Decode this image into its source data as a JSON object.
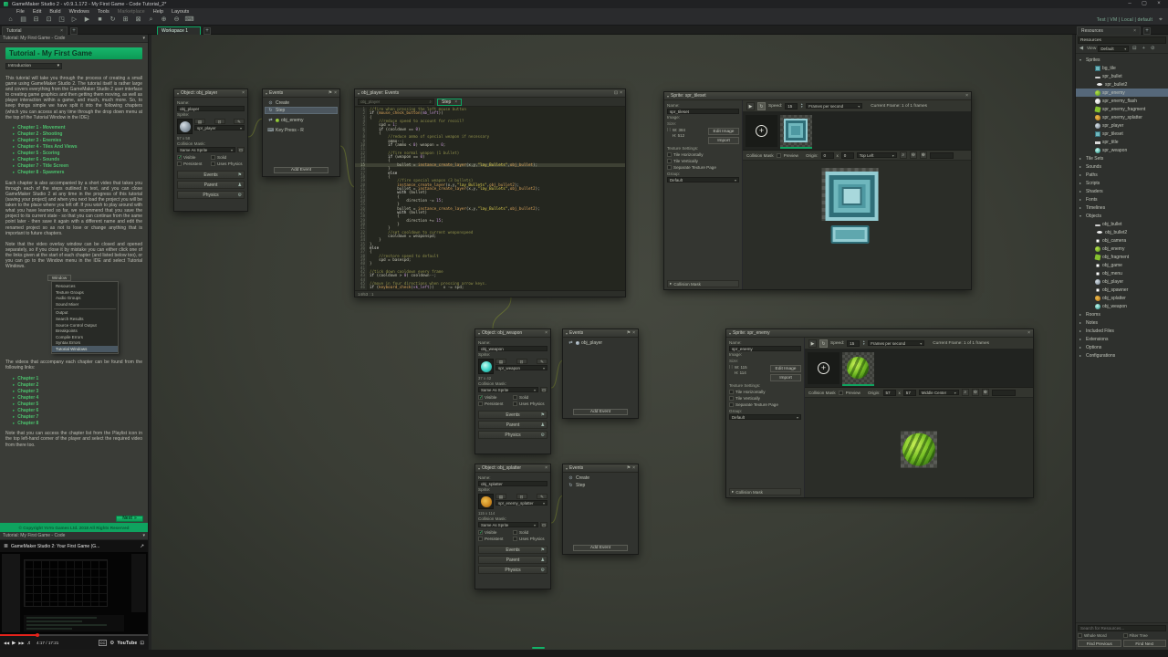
{
  "titlebar": {
    "title": "GameMaker Studio 2 - v0.9.1.172 - My First Game - Code Tutorial_2*",
    "minimize": "–",
    "maximize": "▢",
    "close": "×"
  },
  "menubar": {
    "items": [
      {
        "label": "File"
      },
      {
        "label": "Edit"
      },
      {
        "label": "Build"
      },
      {
        "label": "Windows"
      },
      {
        "label": "Tools"
      },
      {
        "label": "Marketplace",
        "dim": true
      },
      {
        "label": "Help"
      },
      {
        "label": "Layouts"
      }
    ],
    "right_status": "Test | VM | Local | default",
    "target_icon": "⌖"
  },
  "toolbar": {
    "icons": [
      {
        "glyph": "⌂",
        "name": "home-icon"
      },
      {
        "glyph": "▤",
        "name": "new-project-icon"
      },
      {
        "glyph": "⊟",
        "name": "open-project-icon"
      },
      {
        "glyph": "⊡",
        "name": "save-project-icon"
      },
      {
        "glyph": "◳",
        "name": "target-config-icon"
      },
      {
        "glyph": "▷",
        "name": "debug-icon"
      },
      {
        "glyph": "▶",
        "name": "run-icon"
      },
      {
        "glyph": "■",
        "name": "stop-icon"
      },
      {
        "glyph": "↻",
        "name": "clean-icon"
      },
      {
        "glyph": "⊞",
        "name": "game-options-icon"
      },
      {
        "glyph": "⊠",
        "name": "texture-icon"
      },
      {
        "glyph": "⌕",
        "name": "zoom-icon"
      },
      {
        "glyph": "⊕",
        "name": "zoom-in-icon"
      },
      {
        "glyph": "⊖",
        "name": "zoom-out-icon"
      },
      {
        "glyph": "⌨",
        "name": "laptop-icon"
      }
    ]
  },
  "tabs": {
    "tutorial": "Tutorial",
    "workspace": "Workspace 1",
    "resources": "Resources",
    "close": "×",
    "plus": "+"
  },
  "tutorial_panel": {
    "header": "Tutorial: My First Game - Code",
    "title": "Tutorial - My First Game",
    "dropdown_value": "Introduction",
    "para1": "This tutorial will take you through the process of creating a small game using GameMaker Studio 2. The tutorial itself is rather large and covers everything from the GameMaker Studio 2 user interface to creating game graphics and then getting them moving, as well as player interaction within a game, and much, much more. So, to keep things simple we have split it into the following chapters (which you can access at any time through the drop down menu at the top of the Tutorial Window in the IDE):",
    "chapters_full": [
      {
        "label": "Chapter 1 - Movement"
      },
      {
        "label": "Chapter 2 - Shooting"
      },
      {
        "label": "Chapter 3 - Enemies"
      },
      {
        "label": "Chapter 4 - Tiles And Views"
      },
      {
        "label": "Chapter 5 - Scoring"
      },
      {
        "label": "Chapter 6 - Sounds"
      },
      {
        "label": "Chapter 7 - Title Screen"
      },
      {
        "label": "Chapter 8 - Spawners"
      }
    ],
    "para2": "Each chapter is also accompanied by a short video that takes you through each of the steps outlined in text, and you can close GameMaker Studio 2 at any time in the progress of this tutorial (saving your project) and when you next load the project you will be taken to the place where you left off. If you wish to play around with what you have learned so far, we recommend that you save the project to its current state - so that you can continue from the same point later - then save it again with a different name and edit the renamed project so as not to lose or change anything that is important to future chapters.",
    "para3": "Note that the video overlay window can be closed and opened separately, so if you close it by mistake you can either click one of the links given at the start of each chapter (and listed below too), or you can go to the Window menu in the IDE and select Tutorial Windows.",
    "window_menu": {
      "button": "Window",
      "items": [
        {
          "label": "Resources"
        },
        {
          "label": "Texture Groups"
        },
        {
          "label": "Audio Groups"
        },
        {
          "label": "Sound Mixer"
        },
        {
          "sep": true
        },
        {
          "label": "Output"
        },
        {
          "label": "Search Results"
        },
        {
          "label": "Source Control Output"
        },
        {
          "label": "Breakpoints"
        },
        {
          "label": "Compile Errors"
        },
        {
          "label": "Syntax Errors"
        },
        {
          "label": "Tutorial Windows",
          "selected": true
        }
      ]
    },
    "para4": "The videos that accompany each chapter can be found from the following links:",
    "chapters_short": [
      {
        "label": "Chapter 1"
      },
      {
        "label": "Chapter 2"
      },
      {
        "label": "Chapter 3"
      },
      {
        "label": "Chapter 4"
      },
      {
        "label": "Chapter 5"
      },
      {
        "label": "Chapter 6"
      },
      {
        "label": "Chapter 7"
      },
      {
        "label": "Chapter 8"
      }
    ],
    "para5": "Note that you can access the chapter list from the Playlist icon in the top left-hand corner of the player and select the required video from there too.",
    "next_label": "Next",
    "next_arrow": "»",
    "copyright": "© Copyright YoYo Games Ltd. 2018 All Rights Reserved"
  },
  "video_panel": {
    "header": "Tutorial: My First Game - Code",
    "playlist_icon": "≣",
    "title": "GameMaker Studio 2: Your First Game (G...",
    "share_icon": "↗",
    "time": "4:17 / 17:21",
    "progress_pct": 25,
    "controls": {
      "prev": "◀◀",
      "play": "▶",
      "next": "▶▶",
      "volume": "♬",
      "cc": "CC",
      "settings": "⚙",
      "brand": "YouTube",
      "fullscreen": "⊡"
    }
  },
  "windows_objects": {
    "player": {
      "title": "Object: obj_player",
      "name_label": "Name:",
      "name": "obj_player",
      "sprite_label": "Sprite:",
      "sprite": "spr_player",
      "size": "57 x 58",
      "collision_label": "Collision Mask:",
      "collision": "Same As Sprite",
      "check_labels": {
        "visible": "Visible",
        "solid": "Solid",
        "persistent": "Persistent",
        "physics": "Uses Physics"
      },
      "checks": {
        "visible": true,
        "solid": false,
        "persistent": false,
        "physics": false
      },
      "buttons": {
        "events": "Events",
        "parent": "Parent",
        "physics": "Physics"
      }
    },
    "weapon": {
      "title": "Object: obj_weapon",
      "name_label": "Name:",
      "name": "obj_weapon",
      "sprite_label": "Sprite:",
      "sprite": "spr_weapon",
      "size": "37 x 42",
      "collision_label": "Collision Mask:",
      "collision": "Same As Sprite",
      "check_labels": {
        "visible": "Visible",
        "solid": "Solid",
        "persistent": "Persistent",
        "physics": "Uses Physics"
      },
      "checks": {
        "visible": true,
        "solid": false,
        "persistent": false,
        "physics": false
      },
      "buttons": {
        "events": "Events",
        "parent": "Parent",
        "physics": "Physics"
      }
    },
    "splatter": {
      "title": "Object: obj_splatter",
      "name_label": "Name:",
      "name": "obj_splatter",
      "sprite_label": "Sprite:",
      "sprite": "spr_enemy_splatter",
      "size": "115 x 114",
      "collision_label": "Collision Mask:",
      "collision": "Same As Sprite",
      "check_labels": {
        "visible": "Visible",
        "solid": "Solid",
        "persistent": "Persistent",
        "physics": "Uses Physics"
      },
      "checks": {
        "visible": true,
        "solid": false,
        "persistent": false,
        "physics": false
      },
      "buttons": {
        "events": "Events",
        "parent": "Parent",
        "physics": "Physics"
      }
    }
  },
  "windows_events": {
    "player": {
      "title": "Events",
      "items": [
        {
          "label": "Create",
          "icon": "event-create"
        },
        {
          "label": "Step",
          "icon": "event-step",
          "selected": true
        },
        {
          "label": "obj_enemy",
          "icon": "event-collision",
          "icon2": "dot-green",
          "gap": true
        },
        {
          "label": "Key Press - R",
          "icon": "event-keypress",
          "gap": true
        }
      ],
      "add_label": "Add Event"
    },
    "weapon": {
      "title": "Events",
      "items": [
        {
          "label": "obj_player",
          "icon": "event-collision",
          "icon2": "dot-globe"
        }
      ],
      "add_label": "Add Event"
    },
    "splatter": {
      "title": "Events",
      "items": [
        {
          "label": "Create",
          "icon": "event-create"
        },
        {
          "label": "Step",
          "icon": "event-step"
        }
      ],
      "add_label": "Add Event"
    }
  },
  "code_editor": {
    "title": "obj_player: Events",
    "goto_text": "obj_player",
    "search_icon": "⌕",
    "tab": "Step",
    "status": "14/53 : 1",
    "highlight_line": 15,
    "lines": [
      "//fire when pressing the left mouse button",
      "if (mouse_check_button(mb_left))",
      "{",
      "    //reduce speed to account for recoil?",
      "    spd = 1;",
      "    if (cooldown == 0)",
      "    {",
      "        //reduce ammo of special weapon if necessary",
      "        ammo--;",
      "        if (ammo < 0) weapon = 0;",
      "",
      "        //fire normal weapon (1 bullet)",
      "        if (weapon == 0)",
      "        {",
      "            bullet = instance_create_layer(x,y,\"lay_Bullets\",obj_bullet);",
      "        }",
      "        else",
      "        {",
      "            //fire special weapon (3 bullets)",
      "            instance_create_layer(x,y,\"lay_Bullets\",obj_bullet2);",
      "            bullet = instance_create_layer(x,y,\"lay_Bullets\",obj_bullet2);",
      "            with (bullet)",
      "            {",
      "                direction -= 15;",
      "            }",
      "            bullet = instance_create_layer(x,y,\"lay_Bullets\",obj_bullet2);",
      "            with (bullet)",
      "            {",
      "                direction += 15;",
      "            }",
      "        }",
      "        //set cooldown to current weaponspeed",
      "        cooldown = weaponspd;",
      "    }",
      "}",
      "else",
      "{",
      "    //restore speed to default",
      "    spd = basespd;",
      "}",
      "",
      "//tick down cooldown every frame",
      "if (cooldown > 0) cooldown--;",
      "",
      "//move in four directions when pressing arrow keys.",
      "if (keyboard_check(vk_left))    x -= spd;"
    ]
  },
  "windows_sprites": {
    "tileset": {
      "title": "Sprite: spr_tileset",
      "name_label": "Name:",
      "name": "spr_tileset",
      "image_label": "Image:",
      "size_label": "Size:",
      "w_label": "W:",
      "w": "384",
      "h_label": "H:",
      "h": "512",
      "edit_image": "Edit Image",
      "import": "Import",
      "texture_label": "Texture Settings:",
      "tex_checks": [
        {
          "label": "Tile Horizontally"
        },
        {
          "label": "Tile Vertically"
        },
        {
          "label": "Separate Texture Page"
        }
      ],
      "group_label": "Group:",
      "group": "Default",
      "collision_section": "Collision Mask",
      "speed_label": "Speed:",
      "speed": "15",
      "speed_unit": "Frames per second",
      "current_frame": "Current Frame: 1 of 1 frames",
      "mask_label": "Collision Mask",
      "preview_label": "Preview",
      "origin_label": "Origin:",
      "origin_x": "0",
      "origin_sep": "x",
      "origin_y": "0",
      "origin_mode": "Top Left"
    },
    "enemy": {
      "title": "Sprite: spr_enemy",
      "name_label": "Name:",
      "name": "spr_enemy",
      "image_label": "Image:",
      "size_label": "Size:",
      "w_label": "W:",
      "w": "115",
      "h_label": "H:",
      "h": "114",
      "edit_image": "Edit Image",
      "import": "Import",
      "texture_label": "Texture Settings:",
      "tex_checks": [
        {
          "label": "Tile Horizontally"
        },
        {
          "label": "Tile Vertically"
        },
        {
          "label": "Separate Texture Page"
        }
      ],
      "group_label": "Group:",
      "group": "Default",
      "collision_section": "Collision Mask",
      "speed_label": "Speed:",
      "speed": "15",
      "speed_unit": "Frames per second",
      "current_frame": "Current Frame: 1 of 1 frames",
      "mask_label": "Collision Mask",
      "preview_label": "Preview",
      "origin_label": "Origin:",
      "origin_x": "57",
      "origin_sep": "x",
      "origin_y": "57",
      "origin_mode": "Middle Center"
    }
  },
  "resources_panel": {
    "caption": "Resources",
    "view_label": "View",
    "view_value": "Default",
    "tree": [
      {
        "label": "Sprites",
        "kind": true,
        "expanded": true
      },
      {
        "label": "bg_tile",
        "depth": 1,
        "icon": "sprite-tile"
      },
      {
        "label": "spr_bullet",
        "depth": 1,
        "icon": "sprite-bullet"
      },
      {
        "label": "spr_bullet2",
        "depth": 1,
        "icon": "sprite-bullet2"
      },
      {
        "label": "spr_enemy",
        "depth": 1,
        "icon": "sprite-enemy",
        "selected": true
      },
      {
        "label": "spr_enemy_flash",
        "depth": 1,
        "icon": "sprite-flash"
      },
      {
        "label": "spr_enemy_fragment",
        "depth": 1,
        "icon": "sprite-fragment"
      },
      {
        "label": "spr_enemy_splatter",
        "depth": 1,
        "icon": "sprite-splatter"
      },
      {
        "label": "spr_player",
        "depth": 1,
        "icon": "sprite-player"
      },
      {
        "label": "spr_tileset",
        "depth": 1,
        "icon": "sprite-tileset"
      },
      {
        "label": "spr_title",
        "depth": 1,
        "icon": "sprite-title"
      },
      {
        "label": "spr_weapon",
        "depth": 1,
        "icon": "sprite-weapon"
      },
      {
        "label": "Tile Sets",
        "kind": true
      },
      {
        "label": "Sounds",
        "kind": true
      },
      {
        "label": "Paths",
        "kind": true
      },
      {
        "label": "Scripts",
        "kind": true
      },
      {
        "label": "Shaders",
        "kind": true
      },
      {
        "label": "Fonts",
        "kind": true
      },
      {
        "label": "Timelines",
        "kind": true
      },
      {
        "label": "Objects",
        "kind": true,
        "expanded": true
      },
      {
        "label": "obj_bullet",
        "depth": 1,
        "icon": "sprite-bullet"
      },
      {
        "label": "obj_bullet2",
        "depth": 1,
        "icon": "sprite-bullet2"
      },
      {
        "label": "obj_camera",
        "depth": 1,
        "icon": "object-blank"
      },
      {
        "label": "obj_enemy",
        "depth": 1,
        "icon": "sprite-enemy"
      },
      {
        "label": "obj_fragment",
        "depth": 1,
        "icon": "sprite-fragment"
      },
      {
        "label": "obj_game",
        "depth": 1,
        "icon": "object-blank"
      },
      {
        "label": "obj_menu",
        "depth": 1,
        "icon": "object-blank"
      },
      {
        "label": "obj_player",
        "depth": 1,
        "icon": "sprite-player"
      },
      {
        "label": "obj_spawner",
        "depth": 1,
        "icon": "object-blank"
      },
      {
        "label": "obj_splatter",
        "depth": 1,
        "icon": "sprite-splatter"
      },
      {
        "label": "obj_weapon",
        "depth": 1,
        "icon": "sprite-weapon"
      },
      {
        "label": "Rooms",
        "kind": true
      },
      {
        "label": "Notes",
        "kind": true
      },
      {
        "label": "Included Files",
        "kind": true
      },
      {
        "label": "Extensions",
        "kind": true
      },
      {
        "label": "Options",
        "kind": true
      },
      {
        "label": "Configurations",
        "kind": true
      }
    ],
    "footer": {
      "search_placeholder": "Search for Resources...",
      "whole_word": "Whole Word",
      "filter_tree": "Filter Tree",
      "find_prev": "Find Previous",
      "find_next": "Find Next"
    }
  }
}
